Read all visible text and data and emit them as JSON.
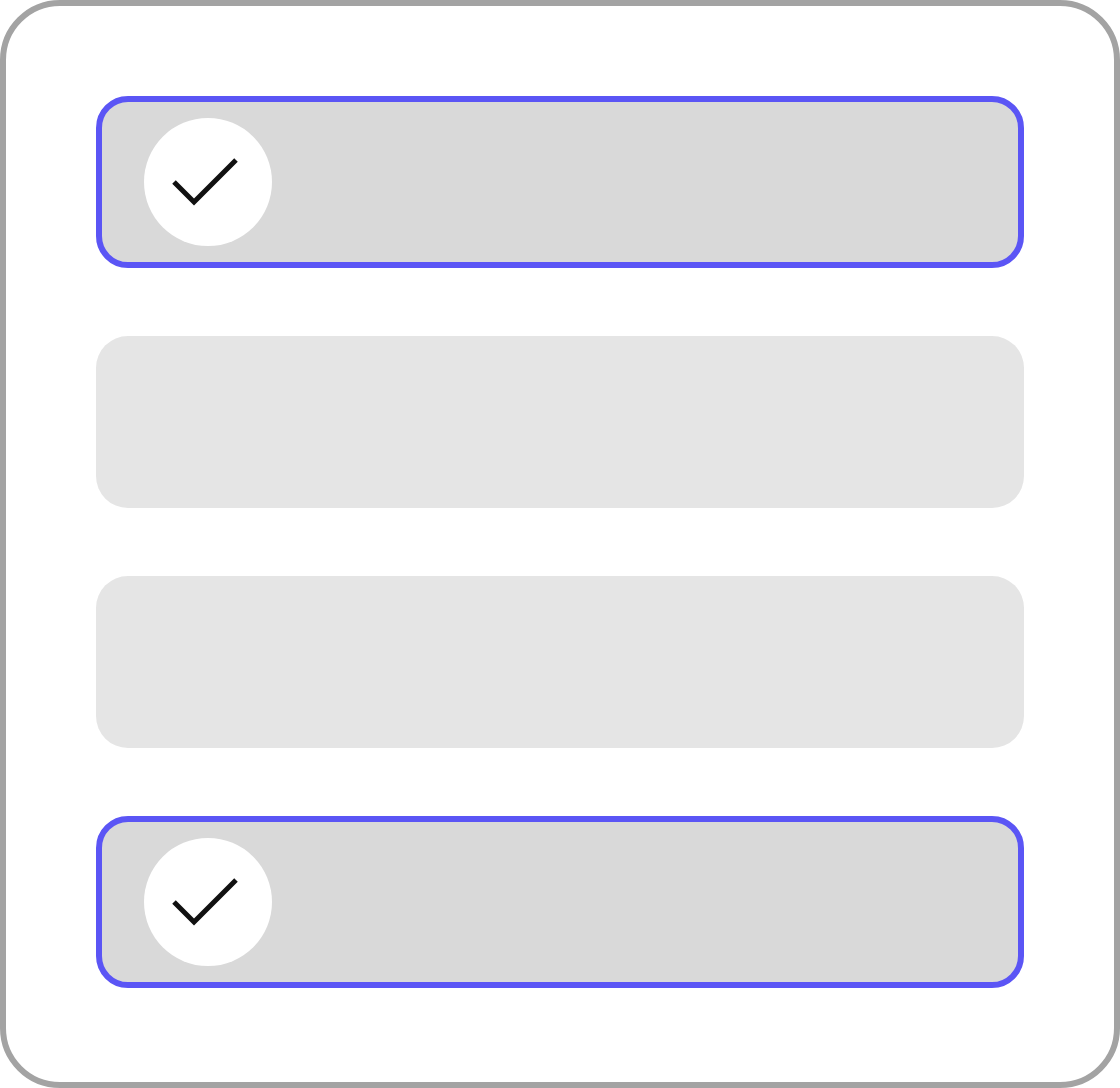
{
  "options": [
    {
      "selected": true
    },
    {
      "selected": false
    },
    {
      "selected": false
    },
    {
      "selected": true
    }
  ]
}
